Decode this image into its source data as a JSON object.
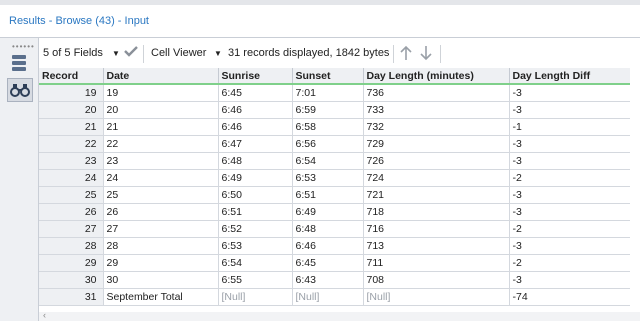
{
  "window": {
    "title": "Results - Browse (43) - Input"
  },
  "toolbar": {
    "fields_label": "5 of 5 Fields",
    "viewer_label": "Cell Viewer",
    "status": "31 records displayed, 1842 bytes"
  },
  "columns": [
    "Record",
    "Date",
    "Sunrise",
    "Sunset",
    "Day Length (minutes)",
    "Day Length Diff"
  ],
  "rows": [
    {
      "record": "19",
      "date": "19",
      "sunrise": "6:45",
      "sunset": "7:01",
      "len": "736",
      "diff": "-3"
    },
    {
      "record": "20",
      "date": "20",
      "sunrise": "6:46",
      "sunset": "6:59",
      "len": "733",
      "diff": "-3"
    },
    {
      "record": "21",
      "date": "21",
      "sunrise": "6:46",
      "sunset": "6:58",
      "len": "732",
      "diff": "-1"
    },
    {
      "record": "22",
      "date": "22",
      "sunrise": "6:47",
      "sunset": "6:56",
      "len": "729",
      "diff": "-3"
    },
    {
      "record": "23",
      "date": "23",
      "sunrise": "6:48",
      "sunset": "6:54",
      "len": "726",
      "diff": "-3"
    },
    {
      "record": "24",
      "date": "24",
      "sunrise": "6:49",
      "sunset": "6:53",
      "len": "724",
      "diff": "-2"
    },
    {
      "record": "25",
      "date": "25",
      "sunrise": "6:50",
      "sunset": "6:51",
      "len": "721",
      "diff": "-3"
    },
    {
      "record": "26",
      "date": "26",
      "sunrise": "6:51",
      "sunset": "6:49",
      "len": "718",
      "diff": "-3"
    },
    {
      "record": "27",
      "date": "27",
      "sunrise": "6:52",
      "sunset": "6:48",
      "len": "716",
      "diff": "-2"
    },
    {
      "record": "28",
      "date": "28",
      "sunrise": "6:53",
      "sunset": "6:46",
      "len": "713",
      "diff": "-3"
    },
    {
      "record": "29",
      "date": "29",
      "sunrise": "6:54",
      "sunset": "6:45",
      "len": "711",
      "diff": "-2"
    },
    {
      "record": "30",
      "date": "30",
      "sunrise": "6:55",
      "sunset": "6:43",
      "len": "708",
      "diff": "-3"
    },
    {
      "record": "31",
      "date": "September Total",
      "sunrise": "[Null]",
      "sunset": "[Null]",
      "len": "[Null]",
      "diff": "-74"
    }
  ],
  "icons": {
    "grip": "grip-dots-icon",
    "rows_view": "table-rows-icon",
    "browse": "binoculars-icon",
    "dropdown": "chevron-down-icon",
    "apply": "check-icon",
    "up": "arrow-up-icon",
    "down": "arrow-down-icon",
    "scroll_left": "chevron-left-icon"
  },
  "colors": {
    "title_blue": "#2b78c2",
    "header_underline": "#7fd08a",
    "null_text": "#9aa0a8"
  }
}
